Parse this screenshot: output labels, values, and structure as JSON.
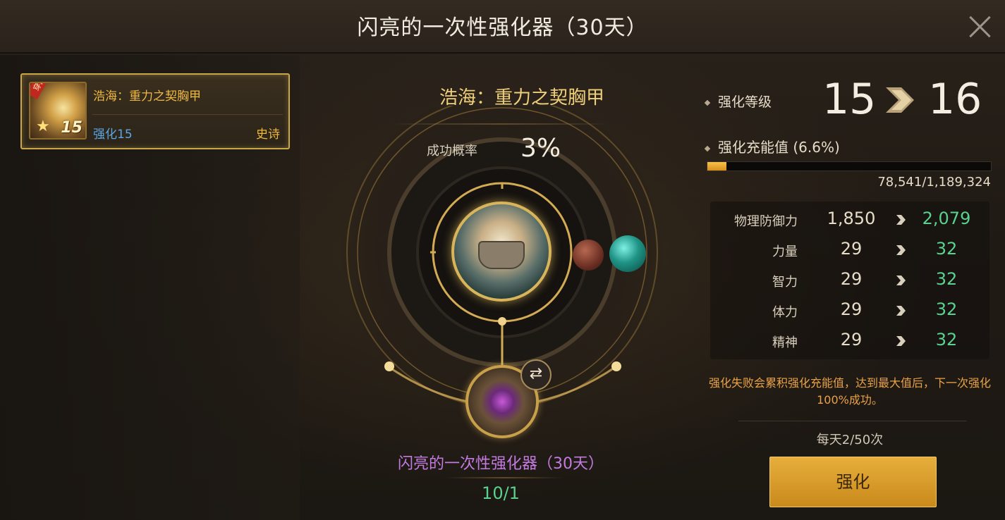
{
  "window": {
    "title": "闪亮的一次性强化器（30天）"
  },
  "item_list": [
    {
      "name": "浩海：重力之契胸甲",
      "enhance": "强化15",
      "grade": "史诗",
      "icon_level": "15",
      "icon_tag": "穿戴中"
    }
  ],
  "center": {
    "item_name": "浩海：重力之契胸甲",
    "success_label": "成功概率",
    "success_rate": "3%",
    "material_name": "闪亮的一次性强化器（30天）",
    "material_count": "10/1"
  },
  "right": {
    "level_label": "强化等级",
    "level_from": "15",
    "level_to": "16",
    "charge_label": "强化充能值 (6.6%)",
    "charge_fraction": 0.066,
    "charge_numbers": "78,541/1,189,324",
    "stats": [
      {
        "name": "物理防御力",
        "old": "1,850",
        "new": "2,079"
      },
      {
        "name": "力量",
        "old": "29",
        "new": "32"
      },
      {
        "name": "智力",
        "old": "29",
        "new": "32"
      },
      {
        "name": "体力",
        "old": "29",
        "new": "32"
      },
      {
        "name": "精神",
        "old": "29",
        "new": "32"
      }
    ],
    "hint": "强化失败会累积强化充能值，达到最大值后，下一次强化100%成功。",
    "daily": "每天2/50次",
    "enhance_button": "强化"
  },
  "colors": {
    "accent_gold": "#efcf7a",
    "stat_green": "#5ad28f",
    "material_purple": "#c37be0",
    "hint_orange": "#e9a248",
    "button_gold": "#e7ae3c"
  },
  "icons": [
    "close-icon",
    "swap-icon",
    "chevron-right-icon",
    "star-icon"
  ]
}
